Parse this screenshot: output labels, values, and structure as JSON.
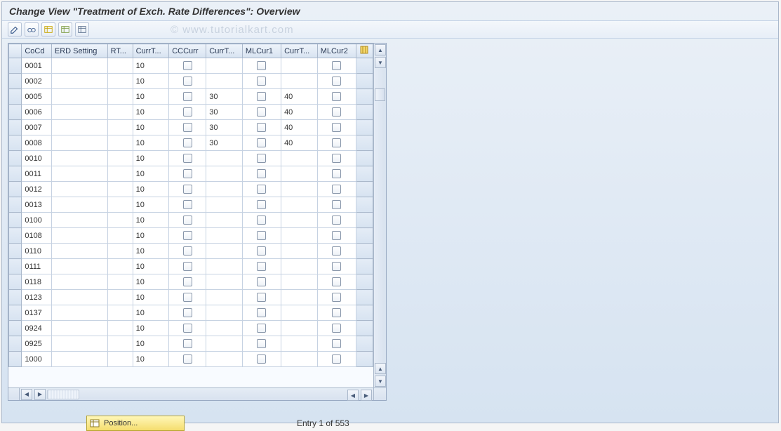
{
  "title": "Change View \"Treatment of Exch. Rate Differences\": Overview",
  "watermark": "© www.tutorialkart.com",
  "toolbar_icons": [
    "edit-icon",
    "glasses-icon",
    "table-new-icon",
    "table-save-icon",
    "table-delete-icon"
  ],
  "columns": {
    "cocd": "CoCd",
    "erd": "ERD Setting",
    "rt": "RT...",
    "currt": "CurrT...",
    "cccurr": "CCCurr",
    "currt2": "CurrT...",
    "mlcur1": "MLCur1",
    "currt3": "CurrT...",
    "mlcur2": "MLCur2"
  },
  "rows": [
    {
      "cocd": "0001",
      "currt": "10",
      "currt2": "",
      "currt3": ""
    },
    {
      "cocd": "0002",
      "currt": "10",
      "currt2": "",
      "currt3": ""
    },
    {
      "cocd": "0005",
      "currt": "10",
      "currt2": "30",
      "currt3": "40"
    },
    {
      "cocd": "0006",
      "currt": "10",
      "currt2": "30",
      "currt3": "40"
    },
    {
      "cocd": "0007",
      "currt": "10",
      "currt2": "30",
      "currt3": "40"
    },
    {
      "cocd": "0008",
      "currt": "10",
      "currt2": "30",
      "currt3": "40"
    },
    {
      "cocd": "0010",
      "currt": "10",
      "currt2": "",
      "currt3": ""
    },
    {
      "cocd": "0011",
      "currt": "10",
      "currt2": "",
      "currt3": ""
    },
    {
      "cocd": "0012",
      "currt": "10",
      "currt2": "",
      "currt3": ""
    },
    {
      "cocd": "0013",
      "currt": "10",
      "currt2": "",
      "currt3": ""
    },
    {
      "cocd": "0100",
      "currt": "10",
      "currt2": "",
      "currt3": ""
    },
    {
      "cocd": "0108",
      "currt": "10",
      "currt2": "",
      "currt3": ""
    },
    {
      "cocd": "0110",
      "currt": "10",
      "currt2": "",
      "currt3": ""
    },
    {
      "cocd": "0111",
      "currt": "10",
      "currt2": "",
      "currt3": ""
    },
    {
      "cocd": "0118",
      "currt": "10",
      "currt2": "",
      "currt3": ""
    },
    {
      "cocd": "0123",
      "currt": "10",
      "currt2": "",
      "currt3": ""
    },
    {
      "cocd": "0137",
      "currt": "10",
      "currt2": "",
      "currt3": ""
    },
    {
      "cocd": "0924",
      "currt": "10",
      "currt2": "",
      "currt3": ""
    },
    {
      "cocd": "0925",
      "currt": "10",
      "currt2": "",
      "currt3": ""
    },
    {
      "cocd": "1000",
      "currt": "10",
      "currt2": "",
      "currt3": ""
    }
  ],
  "footer": {
    "position_label": "Position...",
    "entry_label": "Entry 1 of 553"
  }
}
